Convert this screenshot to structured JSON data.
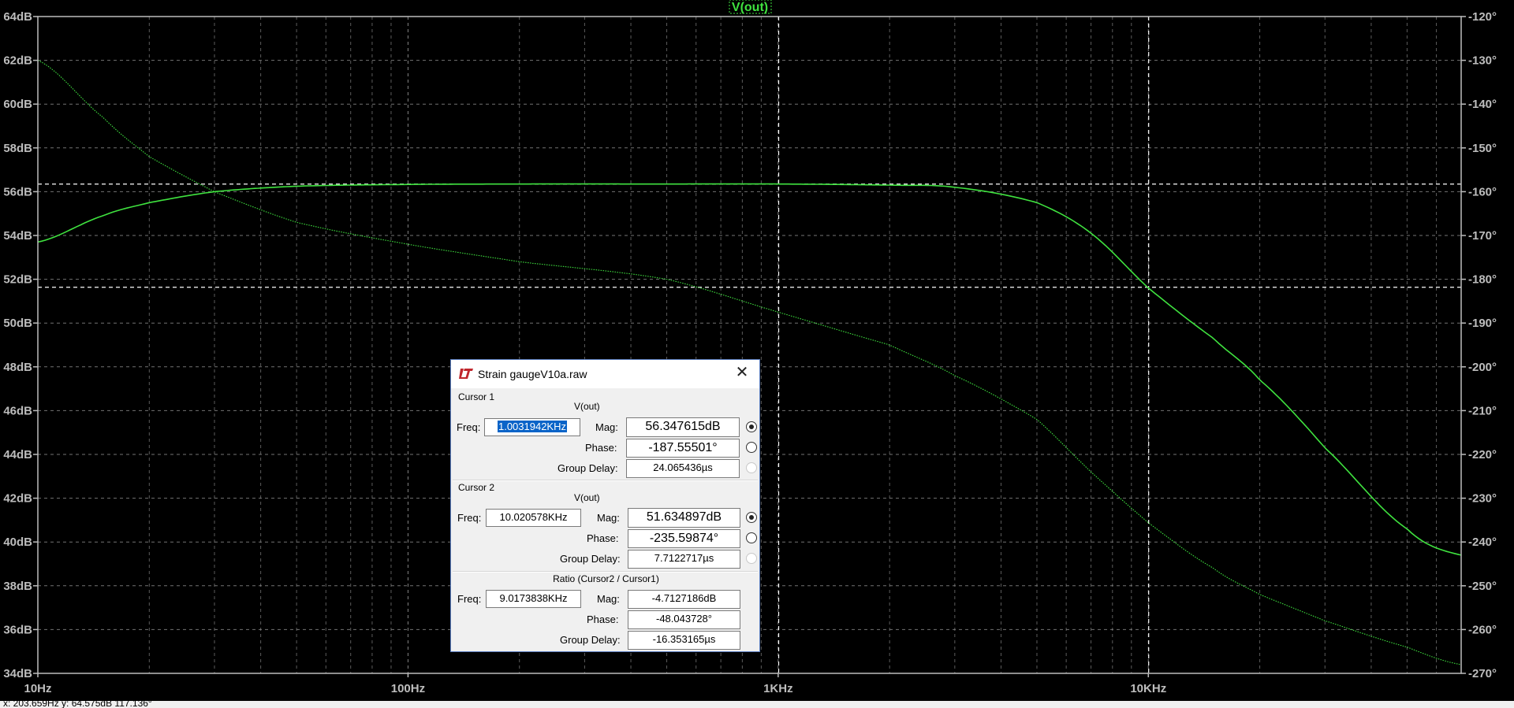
{
  "chart_data": {
    "type": "line",
    "title": "V(out)",
    "xscale": "log",
    "xlim": [
      10,
      70000
    ],
    "x_ticks": [
      {
        "value": 10,
        "label": "10Hz"
      },
      {
        "value": 100,
        "label": "100Hz"
      },
      {
        "value": 1000,
        "label": "1KHz"
      },
      {
        "value": 10000,
        "label": "10KHz"
      }
    ],
    "left_axis": {
      "unit": "dB",
      "ylim": [
        34,
        64
      ],
      "ticks": [
        "64dB",
        "62dB",
        "60dB",
        "58dB",
        "56dB",
        "54dB",
        "52dB",
        "50dB",
        "48dB",
        "46dB",
        "44dB",
        "42dB",
        "40dB",
        "38dB",
        "36dB",
        "34dB"
      ]
    },
    "right_axis": {
      "unit": "deg",
      "ylim": [
        -270,
        -120
      ],
      "ticks": [
        "-120°",
        "-130°",
        "-140°",
        "-150°",
        "-160°",
        "-170°",
        "-180°",
        "-190°",
        "-200°",
        "-210°",
        "-220°",
        "-230°",
        "-240°",
        "-250°",
        "-260°",
        "-270°"
      ]
    },
    "grid": true,
    "series": [
      {
        "name": "V(out)",
        "quantity": "magnitude",
        "axis": "left",
        "style": "solid",
        "x": [
          10,
          15,
          20,
          30,
          50,
          100,
          200,
          500,
          1000,
          2000,
          3000,
          5000,
          7000,
          10000,
          15000,
          20000,
          30000,
          50000,
          70000
        ],
        "y": [
          53.7,
          54.9,
          55.5,
          56.0,
          56.25,
          56.33,
          56.35,
          56.35,
          56.35,
          56.3,
          56.2,
          55.5,
          54.1,
          51.6,
          49.3,
          47.4,
          44.3,
          40.6,
          39.4
        ]
      },
      {
        "name": "",
        "quantity": "phase",
        "axis": "right",
        "style": "dotted",
        "x": [
          10,
          15,
          20,
          30,
          50,
          100,
          200,
          500,
          1000,
          2000,
          3000,
          5000,
          7000,
          10000,
          15000,
          20000,
          30000,
          50000,
          70000
        ],
        "y": [
          -130,
          -143,
          -152,
          -160,
          -167,
          -172,
          -176,
          -180,
          -187.5,
          -195,
          -202,
          -212,
          -224,
          -235.6,
          -246,
          -252,
          -258,
          -264,
          -268
        ]
      }
    ],
    "cursors": [
      {
        "x": 1003.1942,
        "mag": 56.347615,
        "phase": -187.55501
      },
      {
        "x": 10020.578,
        "mag": 51.634897,
        "phase": -235.59874
      }
    ],
    "colors": {
      "trace": "#3fe23f",
      "grid": "#9a9a9a",
      "background": "#000000",
      "cursor": "#ffffff"
    }
  },
  "status_bar": {
    "text": "x: 203.659Hz   y: 64.575dB  117.136°"
  },
  "dialog": {
    "title": "Strain gaugeV10a.raw",
    "close_glyph": "✕",
    "cursor1": {
      "section": "Cursor 1",
      "trace": "V(out)",
      "freq_label": "Freq:",
      "freq": "1.0031942KHz",
      "mag_label": "Mag:",
      "mag": "56.347615dB",
      "phase_label": "Phase:",
      "phase": "-187.55501°",
      "gd_label": "Group Delay:",
      "gd": "24.065436µs"
    },
    "cursor2": {
      "section": "Cursor 2",
      "trace": "V(out)",
      "freq_label": "Freq:",
      "freq": "10.020578KHz",
      "mag_label": "Mag:",
      "mag": "51.634897dB",
      "phase_label": "Phase:",
      "phase": "-235.59874°",
      "gd_label": "Group Delay:",
      "gd": "7.7122717µs"
    },
    "ratio": {
      "section": "Ratio (Cursor2 / Cursor1)",
      "freq_label": "Freq:",
      "freq": "9.0173838KHz",
      "mag_label": "Mag:",
      "mag": "-4.7127186dB",
      "phase_label": "Phase:",
      "phase": "-48.043728°",
      "gd_label": "Group Delay:",
      "gd": "-16.353165µs"
    }
  }
}
